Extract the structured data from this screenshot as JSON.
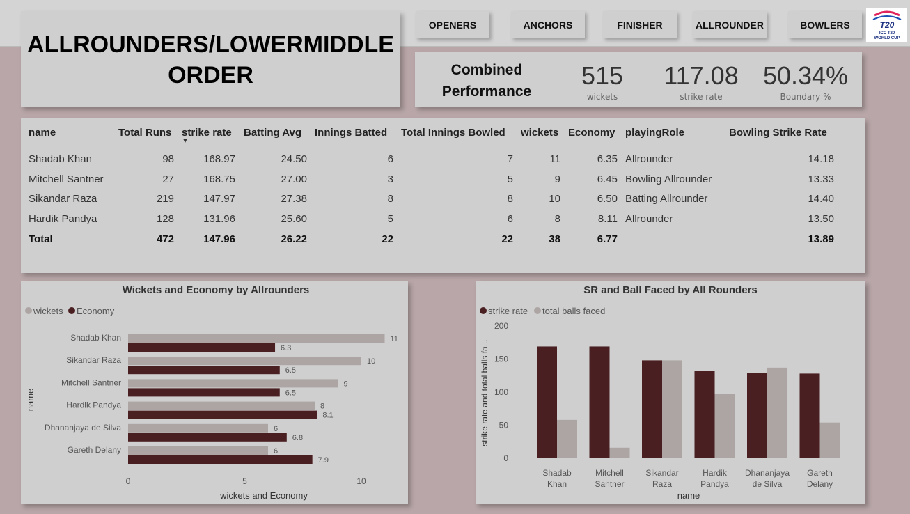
{
  "title": "ALLROUNDERS/LOWERMIDDLE ORDER",
  "title_lines": [
    "ALLROUNDERS/LOWERMIDDLE",
    "ORDER"
  ],
  "nav": [
    {
      "label": "OPENERS"
    },
    {
      "label": "ANCHORS"
    },
    {
      "label": "FINISHER"
    },
    {
      "label": "ALLROUNDER"
    },
    {
      "label": "BOWLERS"
    }
  ],
  "logo": {
    "text1": "T20",
    "text2": "ICC T20",
    "text3": "WORLD CUP"
  },
  "kpi": {
    "title_lines": [
      "Combined",
      "Performance"
    ],
    "items": [
      {
        "value": "515",
        "label": "wickets"
      },
      {
        "value": "117.08",
        "label": "strike rate"
      },
      {
        "value": "50.34%",
        "label": "Boundary %"
      }
    ]
  },
  "table": {
    "headers": [
      "name",
      "Total Runs",
      "strike rate",
      "Batting Avg",
      "Innings Batted",
      "Total Innings Bowled",
      "wickets",
      "Economy",
      "playingRole",
      "Bowling Strike Rate"
    ],
    "rows": [
      [
        "Shadab Khan",
        "98",
        "168.97",
        "24.50",
        "6",
        "7",
        "11",
        "6.35",
        "Allrounder",
        "14.18"
      ],
      [
        "Mitchell Santner",
        "27",
        "168.75",
        "27.00",
        "3",
        "5",
        "9",
        "6.45",
        "Bowling Allrounder",
        "13.33"
      ],
      [
        "Sikandar Raza",
        "219",
        "147.97",
        "27.38",
        "8",
        "8",
        "10",
        "6.50",
        "Batting Allrounder",
        "14.40"
      ],
      [
        "Hardik Pandya",
        "128",
        "131.96",
        "25.60",
        "5",
        "6",
        "8",
        "8.11",
        "Allrounder",
        "13.50"
      ]
    ],
    "total": [
      "Total",
      "472",
      "147.96",
      "26.22",
      "22",
      "22",
      "38",
      "6.77",
      "",
      "13.89"
    ],
    "sort_indicator": "▼"
  },
  "chart_data": [
    {
      "type": "bar",
      "orientation": "horizontal",
      "title": "Wickets and Economy by Allrounders",
      "xlabel": "wickets and Economy",
      "ylabel": "name",
      "xlim": [
        0,
        12
      ],
      "xticks": [
        0,
        5,
        10
      ],
      "legend_position": "top-left",
      "categories": [
        "Shadab Khan",
        "Sikandar Raza",
        "Mitchell Santner",
        "Hardik Pandya",
        "Dhananjaya de Silva",
        "Gareth Delany"
      ],
      "series": [
        {
          "name": "wickets",
          "color": "#aca5a3",
          "values": [
            11,
            10,
            9,
            8,
            6,
            6
          ],
          "labels": [
            "11",
            "10",
            "9",
            "8",
            "6",
            "6"
          ]
        },
        {
          "name": "Economy",
          "color": "#4a1f22",
          "values": [
            6.3,
            6.5,
            6.5,
            8.1,
            6.8,
            7.9
          ],
          "labels": [
            "6.3",
            "6.5",
            "6.5",
            "8.1",
            "6.8",
            "7.9"
          ]
        }
      ]
    },
    {
      "type": "bar",
      "orientation": "vertical",
      "title": "SR and Ball Faced by All Rounders",
      "xlabel": "name",
      "ylabel": "strike rate and total balls fa...",
      "ylim": [
        0,
        200
      ],
      "yticks": [
        0,
        50,
        100,
        150,
        200
      ],
      "legend_position": "top-left",
      "categories": [
        [
          "Shadab",
          "Khan"
        ],
        [
          "Mitchell",
          "Santner"
        ],
        [
          "Sikandar",
          "Raza"
        ],
        [
          "Hardik",
          "Pandya"
        ],
        [
          "Dhananjaya",
          "de Silva"
        ],
        [
          "Gareth",
          "Delany"
        ]
      ],
      "series": [
        {
          "name": "strike rate",
          "color": "#4a1f22",
          "values": [
            169,
            169,
            148,
            132,
            129,
            128
          ]
        },
        {
          "name": "total balls faced",
          "color": "#aca5a3",
          "values": [
            58,
            16,
            148,
            97,
            137,
            54
          ]
        }
      ]
    }
  ]
}
